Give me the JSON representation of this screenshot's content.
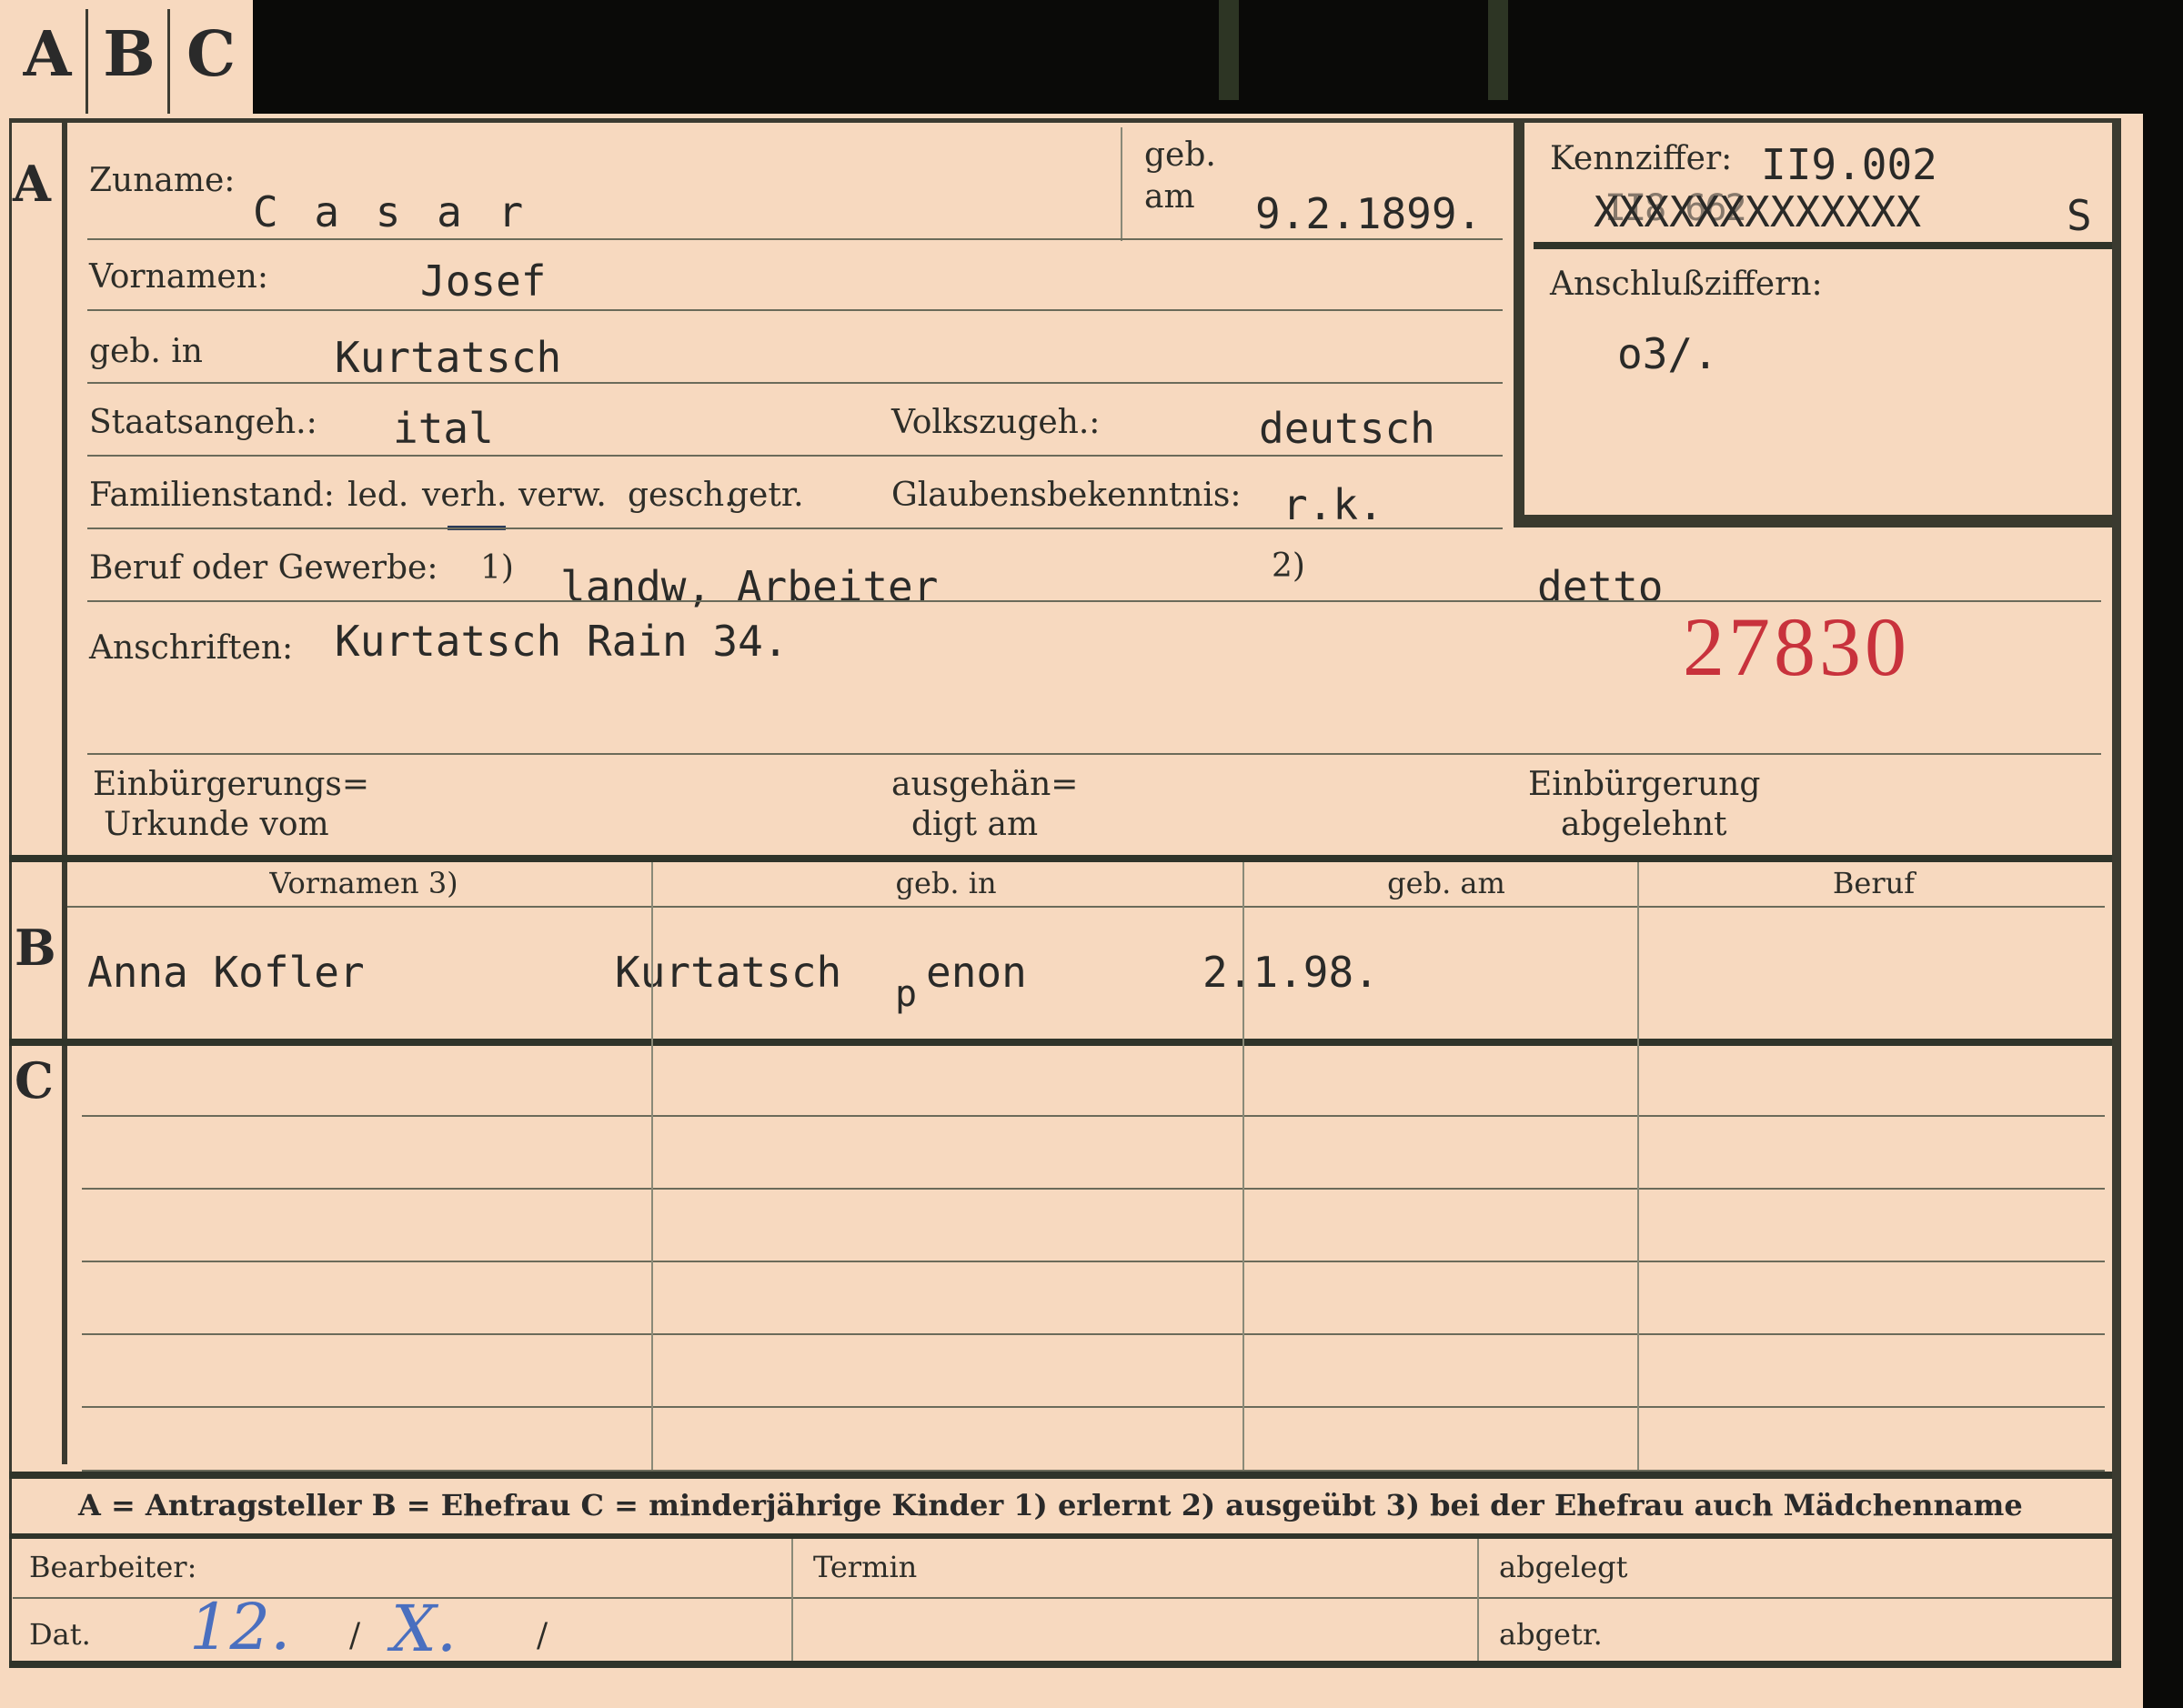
{
  "tabs": [
    "A",
    "B",
    "C"
  ],
  "section_a": {
    "letter": "A",
    "surname_label": "Zuname:",
    "surname_value": "C a s a r",
    "born_label_1": "geb.",
    "born_label_2": "am",
    "born_value": "9.2.1899.",
    "firstnames_label": "Vornamen:",
    "firstnames_value": "Josef",
    "birthplace_label": "geb. in",
    "birthplace_value": "Kurtatsch",
    "citizenship_label": "Staatsangeh.:",
    "citizenship_value": "ital",
    "ethnicity_label": "Volkszugeh.:",
    "ethnicity_value": "deutsch",
    "marital_label": "Familienstand:",
    "marital_options": [
      "led.",
      "verh.",
      "verw.",
      "gesch.",
      "getr."
    ],
    "marital_selected": "verh.",
    "religion_label": "Glaubensbekenntnis:",
    "religion_value": "r.k.",
    "occupation_label": "Beruf oder Gewerbe:",
    "occupation_note_1": "1)",
    "occupation_value_1": "landw, Arbeiter",
    "occupation_note_2": "2)",
    "occupation_value_2": "detto",
    "address_label": "Anschriften:",
    "address_value": "Kurtatsch Rain 34.",
    "stamp_number": "27830",
    "naturalization_cert_label_1": "Einbürgerungs=",
    "naturalization_cert_label_2": "Urkunde vom",
    "handed_label_1": "ausgehän=",
    "handed_label_2": "digt am",
    "naturalization_refused_label_1": "Einbürgerung",
    "naturalization_refused_label_2": "abgelehnt"
  },
  "id_box": {
    "code_label": "Kennziffer:",
    "code_value": "II9.002",
    "code_crossed": "XXXXXXXXXXXXX",
    "code_overwrite": "II8 662",
    "code_suffix": "S",
    "connection_label": "Anschlußziffern:",
    "connection_value": "o3/."
  },
  "section_b": {
    "letter": "B",
    "columns": [
      "Vornamen 3)",
      "geb. in",
      "geb. am",
      "Beruf"
    ],
    "name_value": "Anna Kofler",
    "birthplace_value": "Kurtatsch",
    "birthplace_extra_p": "p",
    "birthplace_extra": "enon",
    "birthdate_value": "2.1.98."
  },
  "section_c": {
    "letter": "C"
  },
  "legend": {
    "text": "A = Antragsteller   B = Ehefrau   C = minderjährige Kinder   1) erlernt   2) ausgeübt   3) bei der Ehefrau auch Mädchenname"
  },
  "footer": {
    "clerk_label": "Bearbeiter:",
    "date_label": "Dat.",
    "date_day": "12.",
    "date_sep_1": "/",
    "date_month": "X.",
    "date_sep_2": "/",
    "deadline_label": "Termin",
    "filed_label": "abgelegt",
    "removed_label": "abgetr."
  }
}
